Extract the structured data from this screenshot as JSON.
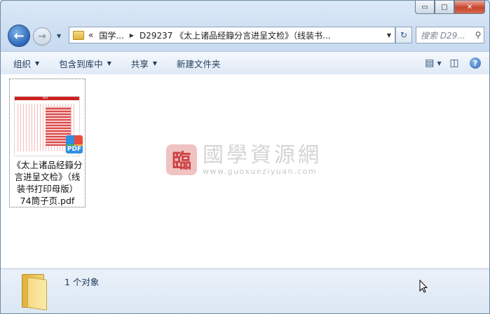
{
  "window": {
    "caption_buttons": {
      "minimize": "▭",
      "maximize": "□",
      "close": "✕"
    }
  },
  "nav": {
    "back_icon": "back-arrow-icon",
    "forward_icon": "forward-arrow-icon",
    "breadcrumb": {
      "overflow": "«",
      "crumb1": "国学...",
      "crumb2": "D29237 《太上诸品经籙分言进呈文检》（线装书..."
    },
    "search_placeholder": "搜索 D29..."
  },
  "toolbar": {
    "organize": "组织",
    "include_library": "包含到库中",
    "share": "共享",
    "new_folder": "新建文件夹"
  },
  "file": {
    "name": "《太上诸品经籙分言进呈文检》（线装书打印母版）74筒子页.pdf",
    "name_lines": [
      "《太上诸品经籙分",
      "言进呈文检》（线",
      "装书打印母版）",
      "74筒子页.pdf"
    ],
    "thumb_header": "PDF",
    "badge": "PDF"
  },
  "watermark": {
    "seal": "臨",
    "chinese": "國學資源網",
    "url": "www.guoxueziyuan.com"
  },
  "details": {
    "count_text": "1 个对象"
  }
}
